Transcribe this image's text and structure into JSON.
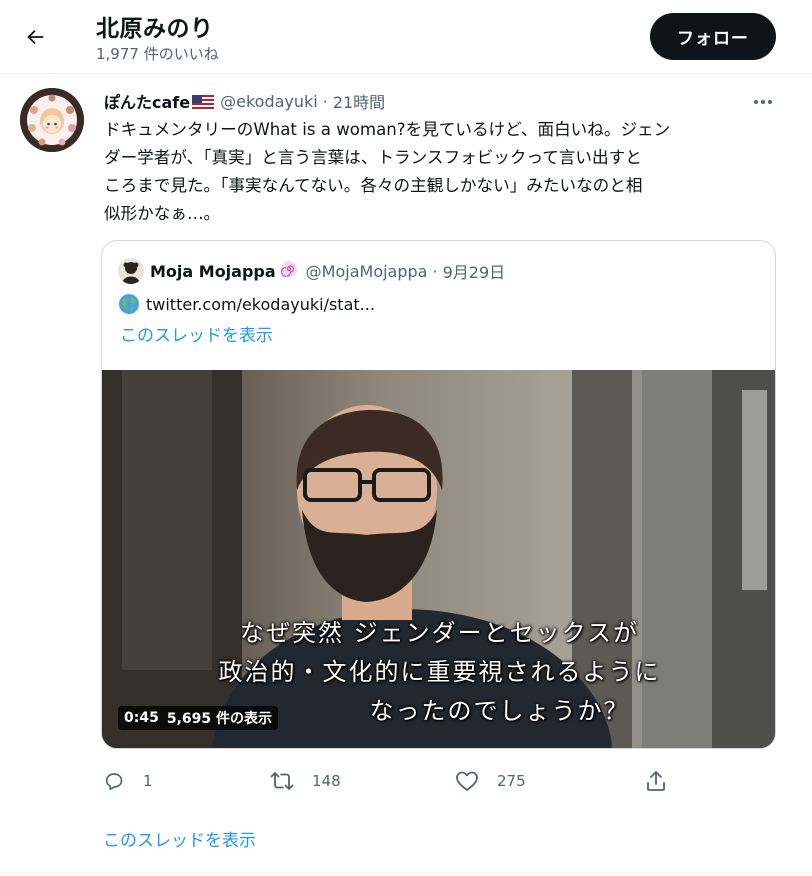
{
  "header": {
    "title": "北原みのり",
    "subtitle": "1,977 件のいいね",
    "follow_label": "フォロー"
  },
  "tweet": {
    "author_name": "ぽんたcafe",
    "flag_icon": "us-flag-emoji",
    "handle": "@ekodayuki",
    "separator": "·",
    "time": "21時間",
    "text_lines": [
      "ドキュメンタリーのWhat is a woman?を見ているけど、面白いね。ジェン",
      "ダー学者が、「真実」と言う言葉は、トランスフォビックって言い出すと",
      "ころまで見た。「事実なんてない。各々の主観しかない」みたいなのと相",
      "似形かなぁ…。"
    ]
  },
  "quote": {
    "author_name": "Moja Mojappa",
    "badge_icon": "spiral-emoji",
    "handle": "@MojaMojappa",
    "separator": "·",
    "date": "9月29日",
    "link_icon": "globe-emoji",
    "link_text": "twitter.com/ekodayuki/stat...",
    "show_thread": "このスレッドを表示",
    "video": {
      "subtitle_lines": [
        "なぜ突然 ジェンダーとセックスが",
        "政治的・文化的に重要視されるように",
        "なったのでしょうか？"
      ],
      "duration": "0:45",
      "views": "5,695 件の表示"
    }
  },
  "actions": {
    "reply_count": "1",
    "retweet_count": "148",
    "like_count": "275"
  },
  "show_thread": "このスレッドを表示",
  "colors": {
    "accent": "#1d9bf0",
    "text": "#0f1419",
    "muted": "#536471",
    "border": "#cfd9de"
  }
}
